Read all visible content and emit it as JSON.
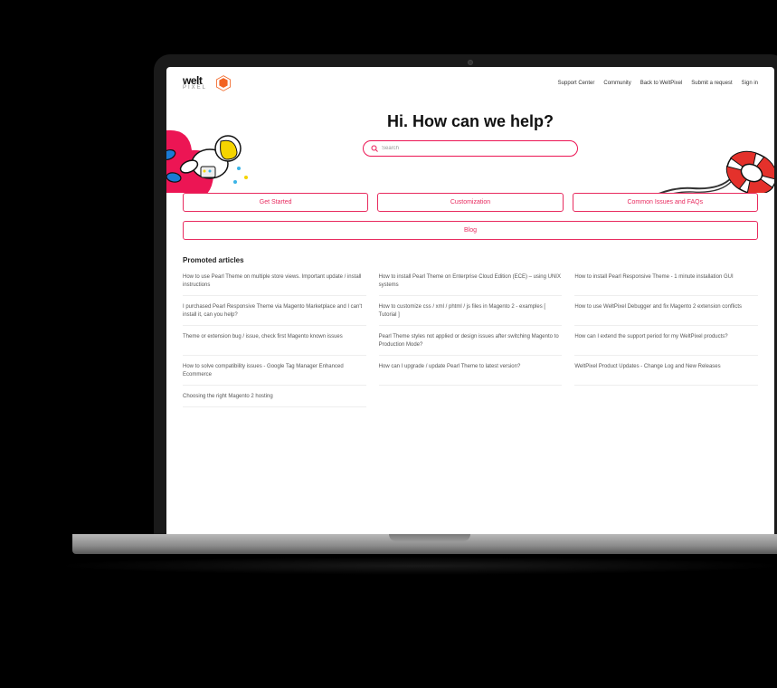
{
  "header": {
    "logo_text": "welt",
    "logo_sub": "PIXEL",
    "nav": [
      "Support Center",
      "Community",
      "Back to WeltPixel",
      "Submit a request",
      "Sign in"
    ]
  },
  "hero": {
    "title": "Hi. How can we help?",
    "search_placeholder": "Search"
  },
  "categories": [
    {
      "label": "Get Started",
      "size": "third"
    },
    {
      "label": "Customization",
      "size": "third"
    },
    {
      "label": "Common Issues and FAQs",
      "size": "third"
    },
    {
      "label": "Blog",
      "size": "full"
    }
  ],
  "promoted": {
    "heading": "Promoted articles",
    "articles": [
      "How to use Pearl Theme on multiple store views. Important update / install instructions",
      "How to install Pearl Theme on Enterprise Cloud Edition (ECE) – using UNIX systems",
      "How to install Pearl Responsive Theme - 1 minute installation GUI",
      "I purchased Pearl Responsive Theme via Magento Marketplace and I can't install it, can you help?",
      "How to customize css / xml / phtml / js files in Magento 2 - examples [ Tutorial ]",
      "How to use WeltPixel Debugger and fix Magento 2 extension conflicts",
      "Theme or extension bug / issue, check first Magento known issues",
      "Pearl Theme styles not applied or design issues after switching Magento to Production Mode?",
      "How can I extend the support period for my WeltPixel products?",
      "How to solve compatibility issues - Google Tag Manager Enhanced Ecommerce",
      "How can I upgrade / update Pearl Theme to latest version?",
      "WeltPixel Product Updates - Change Log and New Releases",
      "Choosing the right Magento 2 hosting"
    ]
  }
}
